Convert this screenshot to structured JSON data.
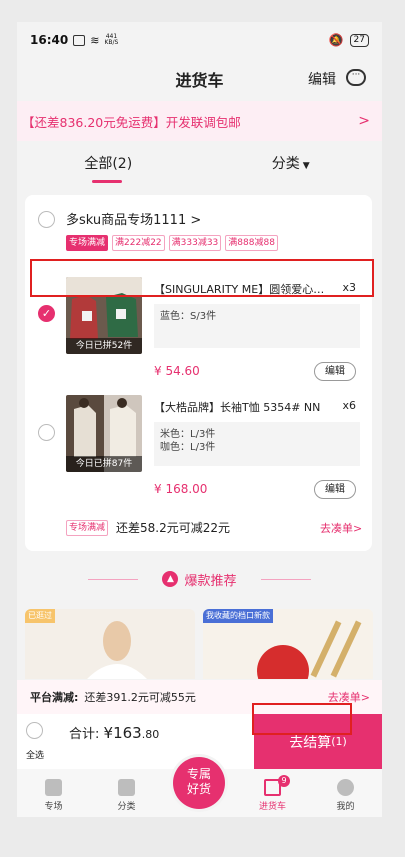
{
  "status_bar": {
    "time": "16:40",
    "network_speed": "441\nKB/S",
    "battery": "27"
  },
  "nav": {
    "title": "进货车",
    "edit": "编辑"
  },
  "notice": {
    "text": "【还差836.20元免运费】开发联调包邮"
  },
  "tabs": [
    {
      "label": "全部(2)"
    },
    {
      "label": "分类"
    }
  ],
  "store": {
    "name": "多sku商品专场1111 >",
    "tags": [
      "专场满减",
      "满222减22",
      "满333减33",
      "满888减88"
    ]
  },
  "products": [
    {
      "title": "【SINGULARITY ME】圆领爱心字...",
      "qty": "x3",
      "specs": [
        "蓝色：S/3件"
      ],
      "price": "¥ 54.60",
      "sold": "今日已拼52件",
      "edit": "编辑",
      "checked": true
    },
    {
      "title": "【大梏品牌】长袖T恤 5354# NN",
      "qty": "x6",
      "specs": [
        "米色：L/3件",
        "咖色：L/3件"
      ],
      "price": "¥ 168.00",
      "sold": "今日已拼87件",
      "edit": "编辑",
      "checked": false
    }
  ],
  "card_footer": {
    "tag": "专场满减",
    "text": "还差58.2元可减22元",
    "more": "去凑单>"
  },
  "recommend": {
    "title": "爆款推荐"
  },
  "rec_items": [
    {
      "badge": "已逛过"
    },
    {
      "badge": "我收藏的档口新款"
    }
  ],
  "platform": {
    "label": "平台满减:",
    "text": "还差391.2元可减55元",
    "more": "去凑单>"
  },
  "checkout": {
    "select_all": "全选",
    "total_label": "合计:",
    "total_main": "¥163",
    "total_dec": ".80",
    "pay_label": "去结算",
    "pay_count": "(1)"
  },
  "tabbar": [
    {
      "label": "专场"
    },
    {
      "label": "分类"
    },
    {
      "label": ""
    },
    {
      "label": "进货车",
      "badge": "9"
    },
    {
      "label": "我的"
    }
  ],
  "center_button": {
    "line1": "专属",
    "line2": "好货"
  },
  "colors": {
    "accent": "#e6306f",
    "highlight_box": "#e02020"
  }
}
